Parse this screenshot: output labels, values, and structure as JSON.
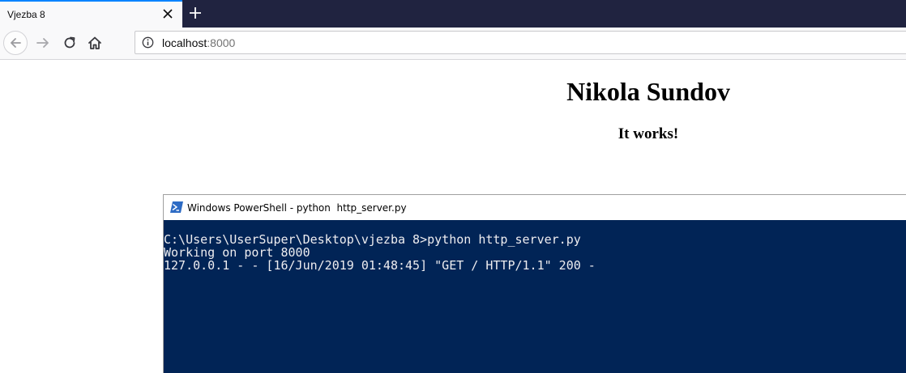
{
  "browser": {
    "tab_title": "Vjezba 8",
    "url_host": "localhost",
    "url_port": ":8000"
  },
  "page": {
    "heading": "Nikola Sundov",
    "subheading": "It works!"
  },
  "powershell": {
    "title": "Windows PowerShell - python  http_server.py",
    "lines": [
      "C:\\Users\\UserSuper\\Desktop\\vjezba 8>python http_server.py",
      "Working on port 8000",
      "127.0.0.1 - - [16/Jun/2019 01:48:45] \"GET / HTTP/1.1\" 200 -"
    ]
  },
  "colors": {
    "tabstrip_bg": "#202340",
    "active_tab_accent": "#0a84ff",
    "console_bg": "#012456",
    "console_text": "#eeedf0"
  }
}
